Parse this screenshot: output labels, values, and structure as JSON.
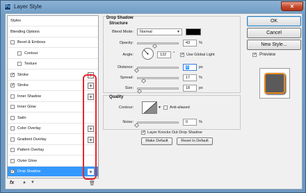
{
  "window": {
    "title": "Layer Style",
    "close_glyph": "×"
  },
  "styles_list": {
    "items": [
      {
        "label": "Styles",
        "checkbox": false,
        "checked": false,
        "plus": false,
        "indent": false,
        "selected": false
      },
      {
        "label": "Blending Options",
        "checkbox": false,
        "checked": false,
        "plus": false,
        "indent": false,
        "selected": false
      },
      {
        "label": "Bevel & Emboss",
        "checkbox": true,
        "checked": false,
        "plus": false,
        "indent": false,
        "selected": false
      },
      {
        "label": "Contour",
        "checkbox": true,
        "checked": false,
        "plus": false,
        "indent": true,
        "selected": false
      },
      {
        "label": "Texture",
        "checkbox": true,
        "checked": false,
        "plus": false,
        "indent": true,
        "selected": false
      },
      {
        "label": "Stroke",
        "checkbox": true,
        "checked": true,
        "plus": true,
        "indent": false,
        "selected": false
      },
      {
        "label": "Stroke",
        "checkbox": true,
        "checked": true,
        "plus": true,
        "indent": false,
        "selected": false
      },
      {
        "label": "Inner Shadow",
        "checkbox": true,
        "checked": false,
        "plus": true,
        "indent": false,
        "selected": false
      },
      {
        "label": "Inner Glow",
        "checkbox": true,
        "checked": false,
        "plus": false,
        "indent": false,
        "selected": false
      },
      {
        "label": "Satin",
        "checkbox": true,
        "checked": false,
        "plus": false,
        "indent": false,
        "selected": false
      },
      {
        "label": "Color Overlay",
        "checkbox": true,
        "checked": false,
        "plus": true,
        "indent": false,
        "selected": false
      },
      {
        "label": "Gradient Overlay",
        "checkbox": true,
        "checked": false,
        "plus": true,
        "indent": false,
        "selected": false
      },
      {
        "label": "Pattern Overlay",
        "checkbox": true,
        "checked": false,
        "plus": false,
        "indent": false,
        "selected": false
      },
      {
        "label": "Outer Glow",
        "checkbox": true,
        "checked": false,
        "plus": false,
        "indent": false,
        "selected": false
      },
      {
        "label": "Drop Shadow",
        "checkbox": true,
        "checked": true,
        "plus": true,
        "indent": false,
        "selected": true
      }
    ],
    "plus_glyph": "+",
    "check_glyph": "✓",
    "tools": {
      "fx": "fx",
      "up": "▲",
      "down": "▼",
      "trash": "🗑"
    }
  },
  "drop_shadow": {
    "title": "Drop Shadow",
    "structure_title": "Structure",
    "blend_mode_label": "Blend Mode:",
    "blend_mode_value": "Normal",
    "blend_color": "#000000",
    "opacity_label": "Opacity:",
    "opacity_value": "43",
    "opacity_pct": 43,
    "angle_label": "Angle:",
    "angle_value": "132",
    "angle_unit": "°",
    "use_global_light_label": "Use Global Light",
    "use_global_light_checked": true,
    "distance_label": "Distance:",
    "distance_value": "0",
    "distance_pct": 0,
    "spread_label": "Spread:",
    "spread_value": "17",
    "spread_pct": 17,
    "size_label": "Size:",
    "size_value": "18",
    "size_pct": 7,
    "unit_px": "px",
    "unit_pct": "%",
    "quality_title": "Quality",
    "contour_label": "Contour:",
    "anti_aliased_label": "Anti-aliased",
    "anti_aliased_checked": false,
    "noise_label": "Noise:",
    "noise_value": "0",
    "noise_pct": 0,
    "knockout_label": "Layer Knocks Out Drop Shadow",
    "knockout_checked": true,
    "make_default_label": "Make Default",
    "reset_default_label": "Reset to Default"
  },
  "right_panel": {
    "ok_label": "OK",
    "cancel_label": "Cancel",
    "new_style_label": "New Style...",
    "preview_label": "Preview",
    "preview_checked": true,
    "preview_fill": "#5a5a5a",
    "preview_border": "#ea8a1b"
  },
  "highlight_color": "#e8232a",
  "selection_color": "#3399ff"
}
